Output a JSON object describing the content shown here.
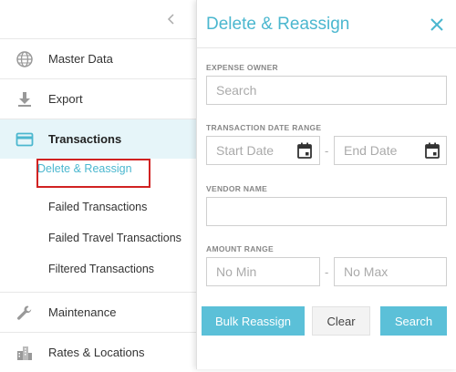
{
  "sidebar": {
    "collapse_icon": "chevron-left-icon",
    "items": [
      {
        "label": "Master Data",
        "icon": "globe-icon"
      },
      {
        "label": "Export",
        "icon": "download-icon"
      },
      {
        "label": "Transactions",
        "icon": "credit-card-icon"
      },
      {
        "label": "Maintenance",
        "icon": "wrench-icon"
      },
      {
        "label": "Rates & Locations",
        "icon": "buildings-icon"
      }
    ],
    "sub_items": [
      {
        "label": "Delete & Reassign"
      },
      {
        "label": "Failed Transactions"
      },
      {
        "label": "Failed Travel Transactions"
      },
      {
        "label": "Filtered Transactions"
      }
    ]
  },
  "panel": {
    "title": "Delete & Reassign",
    "expense_owner": {
      "label": "EXPENSE OWNER",
      "placeholder": "Search"
    },
    "date_range": {
      "label": "TRANSACTION DATE RANGE",
      "start_placeholder": "Start Date",
      "end_placeholder": "End Date",
      "separator": "-"
    },
    "vendor": {
      "label": "VENDOR NAME",
      "placeholder": ""
    },
    "amount_range": {
      "label": "AMOUNT RANGE",
      "min_placeholder": "No Min",
      "max_placeholder": "No Max",
      "separator": "-"
    },
    "buttons": {
      "bulk_reassign": "Bulk Reassign",
      "clear": "Clear",
      "search": "Search"
    }
  },
  "colors": {
    "accent": "#4bb7cf",
    "active_bg": "#e6f5f9",
    "highlight_border": "#d12222"
  }
}
